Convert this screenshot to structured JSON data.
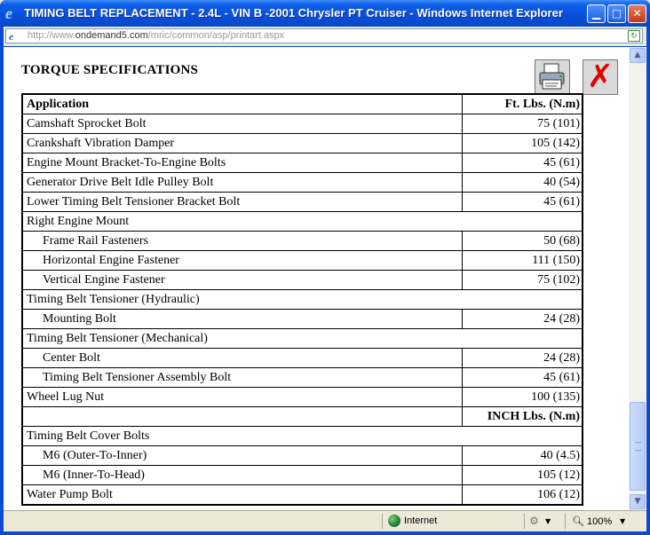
{
  "window": {
    "title": "TIMING BELT REPLACEMENT - 2.4L - VIN B -2001 Chrysler PT Cruiser - Windows Internet Explorer",
    "url_prefix": "http://www.",
    "url_domain": "ondemand5.com",
    "url_path": "/mric/common/asp/printart.aspx"
  },
  "page": {
    "title": "TORQUE SPECIFICATIONS",
    "print_icon": "printer-icon",
    "close_icon": "red-x-icon"
  },
  "table": {
    "header_app": "Application",
    "header_units": "Ft. Lbs. (N.m)",
    "rows": [
      {
        "app": "Camshaft Sprocket Bolt",
        "value": "75 (101)"
      },
      {
        "app": "Crankshaft Vibration Damper",
        "value": "105 (142)"
      },
      {
        "app": "Engine Mount Bracket-To-Engine Bolts",
        "value": "45 (61)"
      },
      {
        "app": "Generator Drive Belt Idle Pulley Bolt",
        "value": "40 (54)"
      },
      {
        "app": "Lower Timing Belt Tensioner Bracket Bolt",
        "value": "45 (61)"
      },
      {
        "app": "Right Engine Mount",
        "value": ""
      },
      {
        "app": "Frame Rail Fasteners",
        "value": "50 (68)"
      },
      {
        "app": "Horizontal Engine Fastener",
        "value": "111 (150)"
      },
      {
        "app": "Vertical Engine Fastener",
        "value": "75 (102)"
      },
      {
        "app": "Timing Belt Tensioner (Hydraulic)",
        "value": ""
      },
      {
        "app": "Mounting Bolt",
        "value": "24 (28)"
      },
      {
        "app": "Timing Belt Tensioner (Mechanical)",
        "value": ""
      },
      {
        "app": "Center Bolt",
        "value": "24 (28)"
      },
      {
        "app": "Timing Belt Tensioner Assembly Bolt",
        "value": "45 (61)"
      },
      {
        "app": "Wheel Lug Nut",
        "value": "100 (135)"
      }
    ],
    "inch_header": "INCH Lbs. (N.m)",
    "inch_rows": [
      {
        "app": "Timing Belt Cover Bolts",
        "value": ""
      },
      {
        "app": "M6 (Outer-To-Inner)",
        "value": "40 (4.5)"
      },
      {
        "app": "M6 (Inner-To-Head)",
        "value": "105 (12)"
      },
      {
        "app": "Water Pump Bolt",
        "value": "106 (12)"
      }
    ]
  },
  "status": {
    "zone": "Internet",
    "zoom": "100%"
  }
}
